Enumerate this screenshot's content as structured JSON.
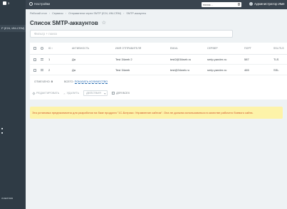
{
  "sidebar": {
    "badge": "3",
    "items": [
      {
        "label": "P (E24, ИМ-CRM)"
      },
      {
        "label": "ложения"
      }
    ]
  },
  "topbar": {
    "settings_label": "Настройки",
    "search_placeholder": "поиск...",
    "user_name": "Администратор Имя"
  },
  "breadcrumbs": [
    "Рабочий стол",
    "Сервисы",
    "Отправители через SMTP (E24, ИМ-CRM)",
    "SMTP-аккаунты"
  ],
  "page": {
    "title": "Список SMTP-аккаунтов"
  },
  "filter": {
    "placeholder": "Фильтр + поиск"
  },
  "grid": {
    "columns": {
      "id": "ID",
      "active": "АКТИВНОСТЬ",
      "sender_name": "ИМЯ ОТПРАВИТЕЛЯ",
      "email": "EMAIL",
      "server": "СЕРВЕР",
      "port": "ПОРТ",
      "ssl": "SSL/TLS"
    },
    "sort_marker": "↑",
    "rows": [
      {
        "id": "1",
        "active": "Да",
        "sender_name": "Test 34web 2",
        "email": "test2@34web.ru",
        "server": "smtp.yandex.ru",
        "port": "587",
        "ssl": "TLS"
      },
      {
        "id": "2",
        "active": "Да",
        "sender_name": "Test 34web",
        "email": "test@34web.ru",
        "server": "smtp.yandex.ru",
        "port": "465",
        "ssl": "SSL"
      }
    ],
    "footer": {
      "selected_label": "ОТМЕЧЕНО:",
      "selected_count": "0",
      "total_label": "ВСЕГО:",
      "total_link": "ПОКАЗАТЬ КОЛИЧЕСТВО"
    },
    "actions": {
      "edit": "РЕДАКТИРОВАТЬ",
      "delete": "УДАЛИТЬ",
      "select": "ДЕЙСТВИЯ",
      "all": "ДЛЯ ВСЕХ"
    }
  },
  "warning": {
    "text": "Эта установка предназначена для разработки на базе продукта \"1С-Битрикс: Управление сайтом\". Она не должна использоваться в качестве рабочего боевого сайта."
  }
}
